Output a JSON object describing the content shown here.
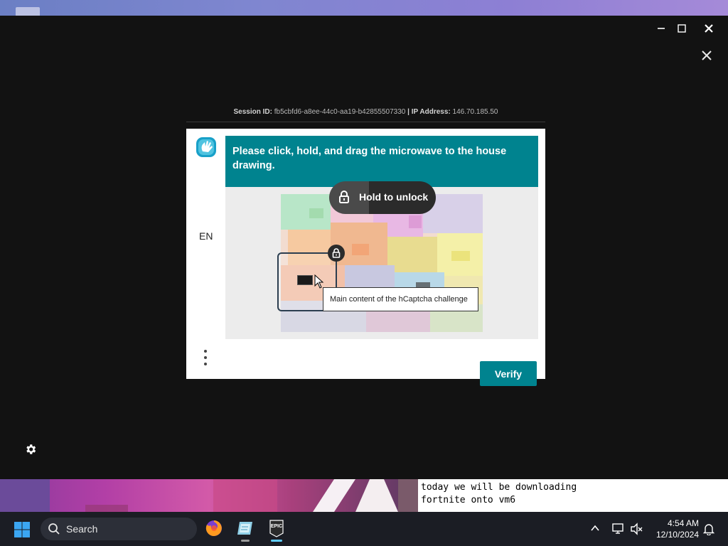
{
  "window": {
    "session_label": "Session ID:",
    "session_id": "fb5cbfd6-a8ee-44c0-aa19-b42855507330",
    "ip_label": "| IP Address:",
    "ip_address": "146.70.185.50"
  },
  "captcha": {
    "prompt": "Please click, hold, and drag the microwave to the house drawing.",
    "hold_to_unlock": "Hold to unlock",
    "tooltip": "Main content of the hCaptcha challenge",
    "language": "EN",
    "verify_label": "Verify",
    "colors": {
      "accent": "#00838f"
    }
  },
  "subtitle": {
    "line1": "today we will be downloading",
    "line2": "fortnite onto vm6"
  },
  "taskbar": {
    "search_label": "Search",
    "apps": [
      "firefox-icon",
      "notepad-icon",
      "epic-games-icon"
    ],
    "epic_label": "EPIC",
    "clock_time": "4:54 AM",
    "clock_date": "12/10/2024"
  }
}
